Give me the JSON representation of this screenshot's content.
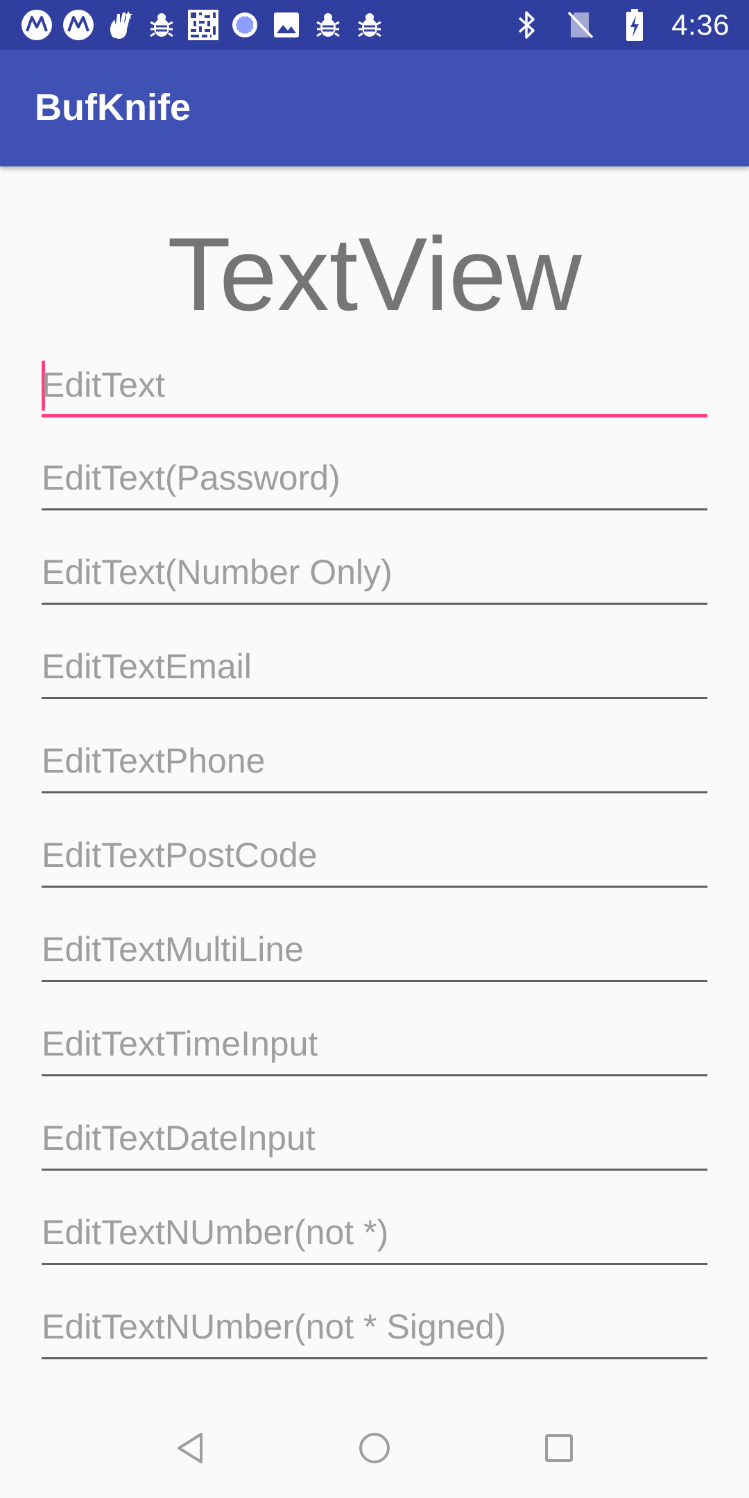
{
  "status_bar": {
    "time": "4:36",
    "left_icons": [
      "motorola-icon",
      "motorola-icon",
      "hand-sparkle-icon",
      "bug-icon",
      "qr-code-icon",
      "sync-circle-icon",
      "image-icon",
      "bug-icon",
      "bug-icon"
    ],
    "right_icons": [
      "bluetooth-icon",
      "no-sim-icon",
      "battery-charging-icon"
    ]
  },
  "app_bar": {
    "title": "BufKnife",
    "color": "#3f51b5",
    "status_color": "#303f9f"
  },
  "main": {
    "text_view": "TextView",
    "fields": [
      {
        "placeholder": "EditText",
        "focused": true
      },
      {
        "placeholder": "EditText(Password)"
      },
      {
        "placeholder": "EditText(Number Only)"
      },
      {
        "placeholder": "EditTextEmail"
      },
      {
        "placeholder": "EditTextPhone"
      },
      {
        "placeholder": "EditTextPostCode"
      },
      {
        "placeholder": "EditTextMultiLine"
      },
      {
        "placeholder": "EditTextTimeInput"
      },
      {
        "placeholder": "EditTextDateInput"
      },
      {
        "placeholder": "EditTextNUmber(not *)"
      },
      {
        "placeholder": "EditTextNUmber(not * Signed)"
      }
    ],
    "accent_color": "#ff4081"
  },
  "nav_bar": {
    "buttons": [
      "back-icon",
      "home-icon",
      "recents-icon"
    ]
  }
}
